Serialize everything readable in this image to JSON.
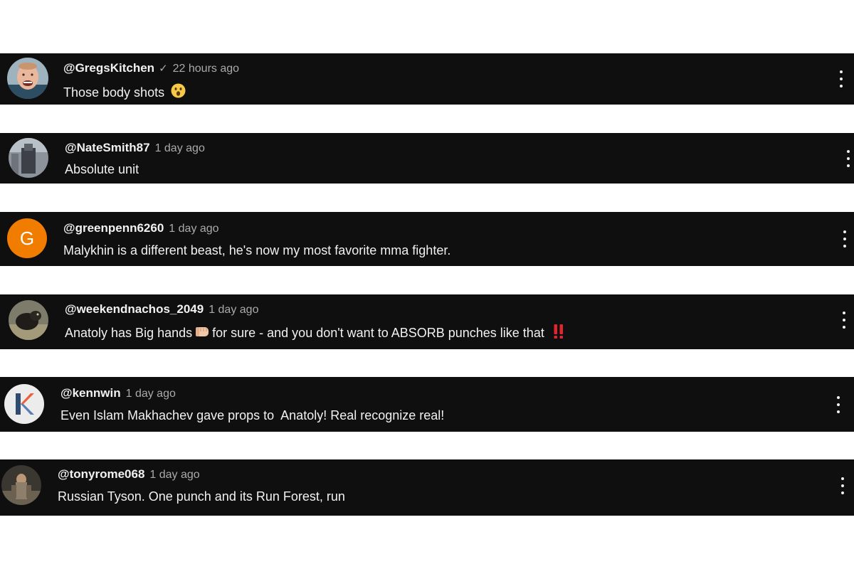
{
  "comments": [
    {
      "handle": "@GregsKitchen",
      "verified": true,
      "time": "22 hours ago",
      "text": "Those body shots",
      "emoji": "face-with-open-mouth",
      "avatar": {
        "kind": "photo-face"
      }
    },
    {
      "handle": "@NateSmith87",
      "verified": false,
      "time": "1 day ago",
      "text": "Absolute unit",
      "avatar": {
        "kind": "photo-grey"
      }
    },
    {
      "handle": "@greenpenn6260",
      "verified": false,
      "time": "1 day ago",
      "text": "Malykhin is a different beast, he's now my most favorite mma fighter.",
      "avatar": {
        "kind": "letter",
        "letter": "G",
        "color": "#f07c00"
      }
    },
    {
      "handle": "@weekendnachos_2049",
      "verified": false,
      "time": "1 day ago",
      "text_before": "Anatoly has Big hands",
      "text_after": "for sure - and you don't want to ABSORB punches like that",
      "emoji_1": "oncoming-fist",
      "emoji_2": "double-exclamation-mark",
      "avatar": {
        "kind": "photo-animal"
      }
    },
    {
      "handle": "@kennwin",
      "verified": false,
      "time": "1 day ago",
      "text": "Even Islam Makhachev gave props to  Anatoly! Real recognize real!",
      "avatar": {
        "kind": "logo-k"
      }
    },
    {
      "handle": "@tonyrome068",
      "verified": false,
      "time": "1 day ago",
      "text": "Russian Tyson. One punch and its Run Forest, run",
      "avatar": {
        "kind": "photo-figure"
      }
    }
  ],
  "colors": {
    "card_background": "#0f0f0f",
    "text_primary": "#f1f1f1",
    "text_secondary": "#aaaaaa",
    "accent_red": "#e0262c"
  }
}
